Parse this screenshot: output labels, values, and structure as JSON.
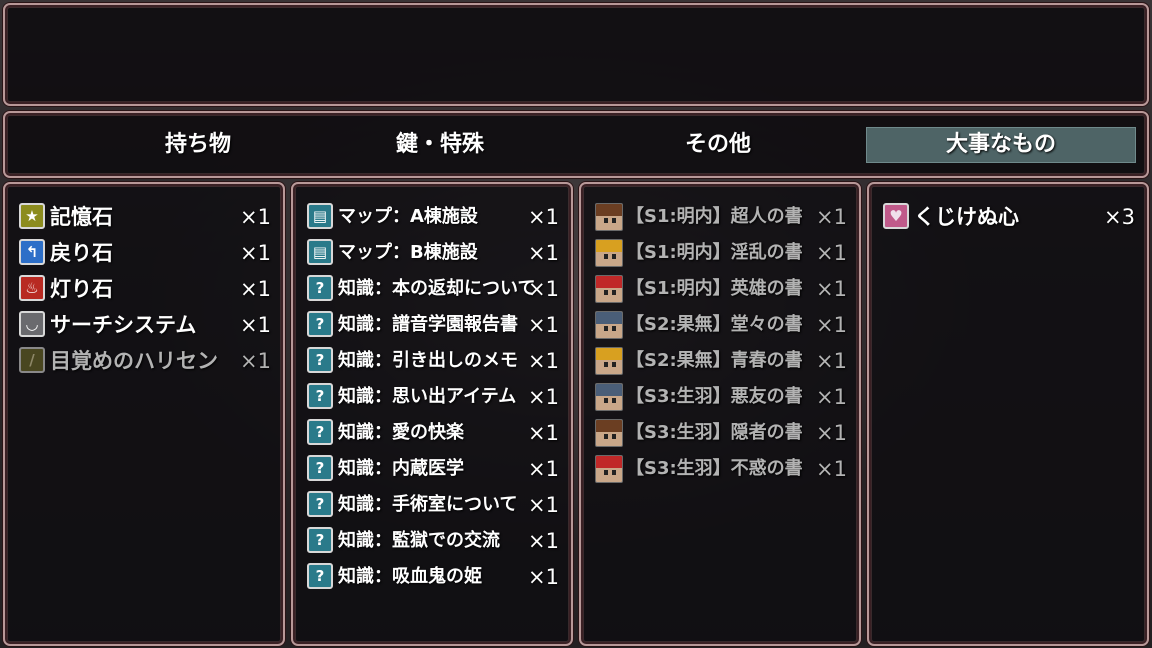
{
  "help_text": "",
  "tabs": [
    {
      "label": "持ち物",
      "selected": false
    },
    {
      "label": "鍵・特殊",
      "selected": false
    },
    {
      "label": "その他",
      "selected": false
    },
    {
      "label": "大事なもの",
      "selected": true
    }
  ],
  "col1": [
    {
      "name": "記憶石",
      "qty": "×1",
      "icon": "star-icon",
      "icon_glyph": "★",
      "icon_bg": "#8c8c1e",
      "icon_fg": "#ffffff",
      "dim": false
    },
    {
      "name": "戻り石",
      "qty": "×1",
      "icon": "return-arrow-icon",
      "icon_glyph": "↰",
      "icon_bg": "#2d6fc8",
      "icon_fg": "#ffffff",
      "dim": false
    },
    {
      "name": "灯り石",
      "qty": "×1",
      "icon": "flame-icon",
      "icon_glyph": "♨",
      "icon_bg": "#b82a22",
      "icon_fg": "#ffffff",
      "dim": false
    },
    {
      "name": "サーチシステム",
      "qty": "×1",
      "icon": "closed-eye-icon",
      "icon_glyph": "◡",
      "icon_bg": "#6a6a6e",
      "icon_fg": "#ffffff",
      "dim": false
    },
    {
      "name": "目覚めのハリセン",
      "qty": "×1",
      "icon": "paper-fan-icon",
      "icon_glyph": "/",
      "icon_bg": "#6e6a28",
      "icon_fg": "#e0d6a0",
      "dim": true
    }
  ],
  "col2": [
    {
      "name": "マップ：A棟施設",
      "qty": "×1",
      "icon": "map-icon",
      "icon_glyph": "▤",
      "icon_bg": "#2a7a8a",
      "dim": false
    },
    {
      "name": "マップ：B棟施設",
      "qty": "×1",
      "icon": "map-icon",
      "icon_glyph": "▤",
      "icon_bg": "#2a7a8a",
      "dim": false
    },
    {
      "name": "知識：本の返却について",
      "qty": "×1",
      "icon": "question-icon",
      "icon_glyph": "?",
      "icon_bg": "#2a7a8a",
      "dim": false
    },
    {
      "name": "知識：譜音学園報告書",
      "qty": "×1",
      "icon": "question-icon",
      "icon_glyph": "?",
      "icon_bg": "#2a7a8a",
      "dim": false
    },
    {
      "name": "知識：引き出しのメモ",
      "qty": "×1",
      "icon": "question-icon",
      "icon_glyph": "?",
      "icon_bg": "#2a7a8a",
      "dim": false
    },
    {
      "name": "知識：思い出アイテム",
      "qty": "×1",
      "icon": "question-icon",
      "icon_glyph": "?",
      "icon_bg": "#2a7a8a",
      "dim": false
    },
    {
      "name": "知識：愛の快楽",
      "qty": "×1",
      "icon": "question-icon",
      "icon_glyph": "?",
      "icon_bg": "#2a7a8a",
      "dim": false
    },
    {
      "name": "知識：内蔵医学",
      "qty": "×1",
      "icon": "question-icon",
      "icon_glyph": "?",
      "icon_bg": "#2a7a8a",
      "dim": false
    },
    {
      "name": "知識：手術室について",
      "qty": "×1",
      "icon": "question-icon",
      "icon_glyph": "?",
      "icon_bg": "#2a7a8a",
      "dim": false
    },
    {
      "name": "知識：監獄での交流",
      "qty": "×1",
      "icon": "question-icon",
      "icon_glyph": "?",
      "icon_bg": "#2a7a8a",
      "dim": false
    },
    {
      "name": "知識：吸血鬼の姫",
      "qty": "×1",
      "icon": "question-icon",
      "icon_glyph": "?",
      "icon_bg": "#2a7a8a",
      "dim": false
    }
  ],
  "col3": [
    {
      "name": "【S1:明内】超人の書",
      "qty": "×1",
      "icon": "character-portrait-icon",
      "hair": "#6b3e22",
      "dim": true
    },
    {
      "name": "【S1:明内】淫乱の書",
      "qty": "×1",
      "icon": "character-portrait-icon",
      "hair": "#d8a020",
      "dim": true
    },
    {
      "name": "【S1:明内】英雄の書",
      "qty": "×1",
      "icon": "character-portrait-icon",
      "hair": "#c02828",
      "dim": true
    },
    {
      "name": "【S2:果無】堂々の書",
      "qty": "×1",
      "icon": "character-portrait-icon",
      "hair": "#4a5e78",
      "dim": true
    },
    {
      "name": "【S2:果無】青春の書",
      "qty": "×1",
      "icon": "character-portrait-icon",
      "hair": "#d8a020",
      "dim": true
    },
    {
      "name": "【S3:生羽】悪友の書",
      "qty": "×1",
      "icon": "character-portrait-icon",
      "hair": "#4a5e78",
      "dim": true
    },
    {
      "name": "【S3:生羽】隠者の書",
      "qty": "×1",
      "icon": "character-portrait-icon",
      "hair": "#6b3e22",
      "dim": true
    },
    {
      "name": "【S3:生羽】不惑の書",
      "qty": "×1",
      "icon": "character-portrait-icon",
      "hair": "#c02828",
      "dim": true
    }
  ],
  "col4": [
    {
      "name": "くじけぬ心",
      "qty": "×3",
      "icon": "heart-icon",
      "icon_glyph": "♥",
      "icon_bg": "#c05a8a",
      "icon_fg": "#f0e0ec",
      "dim": false
    }
  ]
}
